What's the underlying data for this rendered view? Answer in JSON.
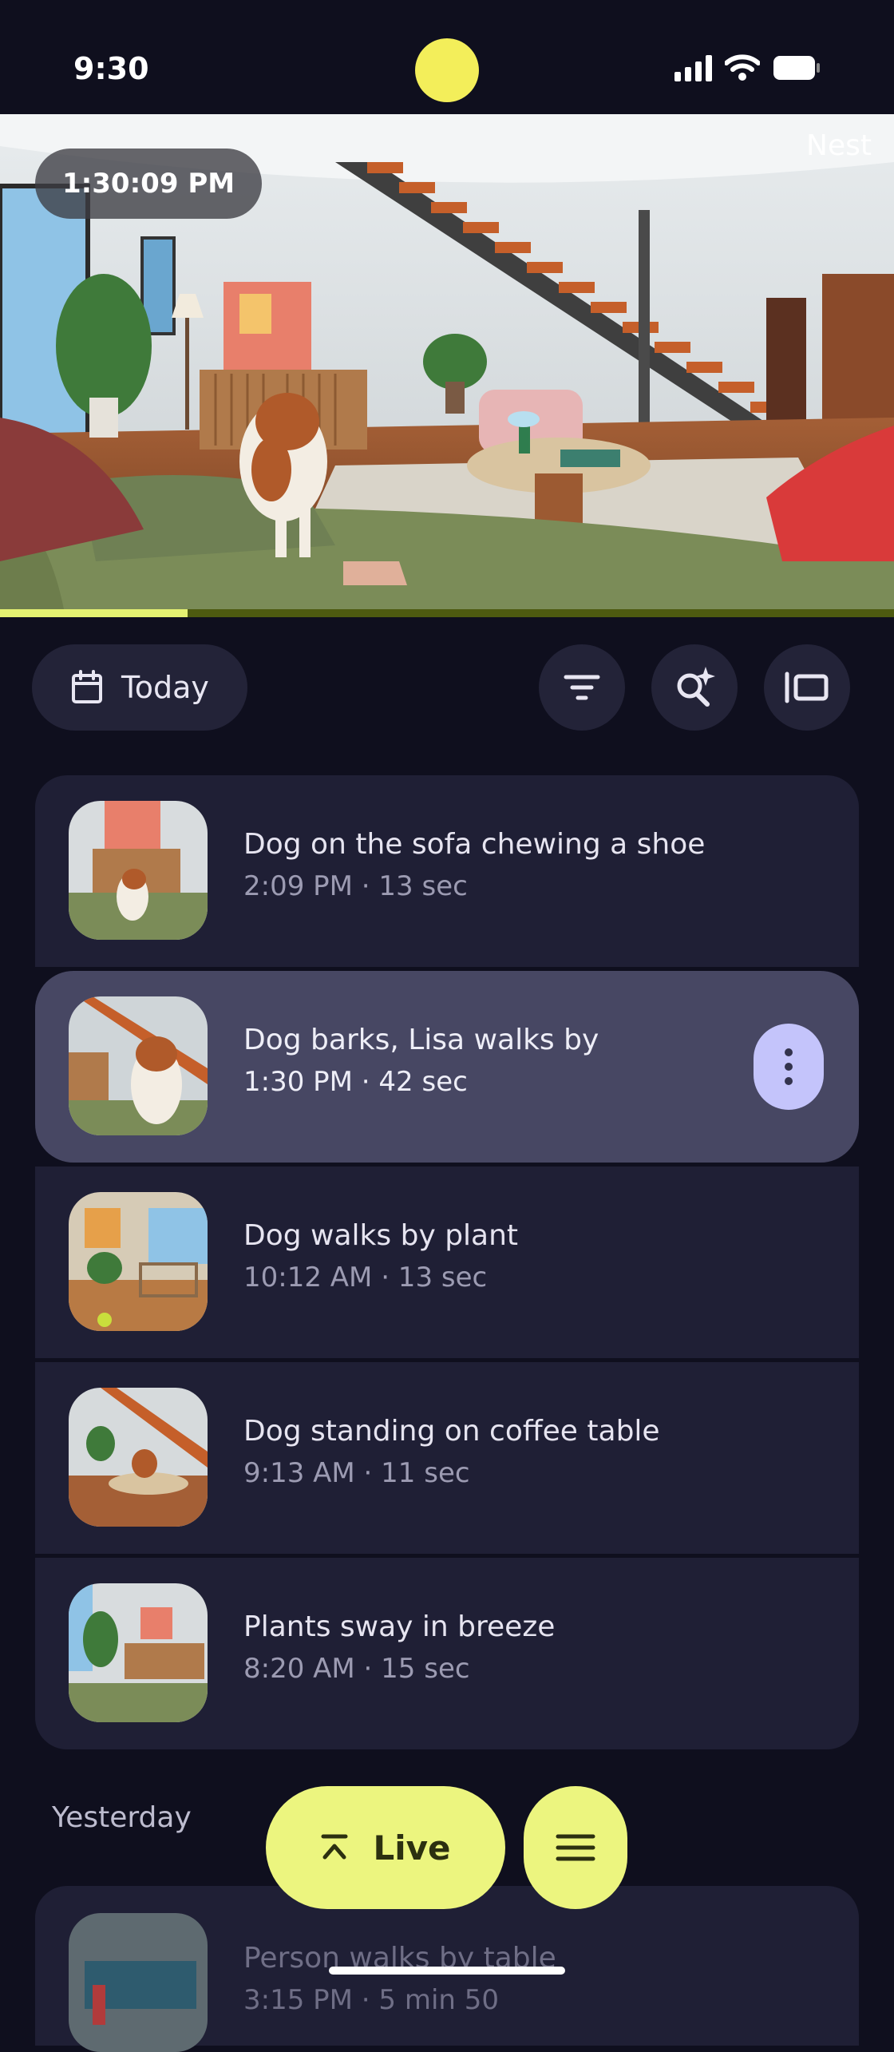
{
  "status_bar": {
    "time": "9:30"
  },
  "feed": {
    "timestamp": "1:30:09 PM",
    "brand": "Nest",
    "progress": 0.21
  },
  "toolbar": {
    "date_chip_label": "Today"
  },
  "events_today": [
    {
      "title": "Dog on the sofa chewing a shoe",
      "meta": "2:09 PM · 13 sec"
    },
    {
      "title": "Dog barks, Lisa walks by",
      "meta": "1:30 PM · 42 sec"
    },
    {
      "title": "Dog walks by plant",
      "meta": "10:12 AM · 13 sec"
    },
    {
      "title": "Dog standing on coffee table",
      "meta": "9:13 AM · 11 sec"
    },
    {
      "title": "Plants sway in breeze",
      "meta": "8:20 AM · 15 sec"
    }
  ],
  "yesterday": {
    "label": "Yesterday",
    "events": [
      {
        "title": "Person walks by table",
        "meta": "3:15 PM · 5 min 50"
      }
    ]
  },
  "fab": {
    "live_label": "Live"
  },
  "colors": {
    "accent": "#ecf57f",
    "background": "#0f0f1e",
    "card": "#1f1f35",
    "selected_card": "#474763"
  }
}
